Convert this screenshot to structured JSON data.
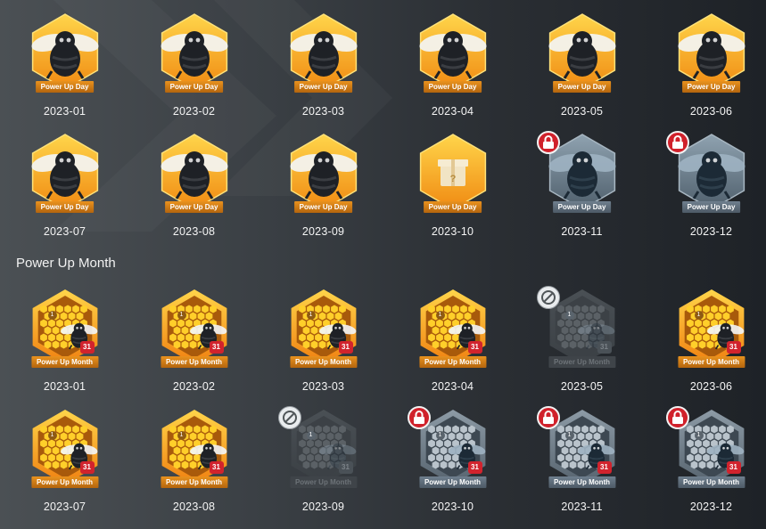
{
  "day_badges": {
    "ribbon": "Power Up Day",
    "rows": [
      [
        {
          "period": "2023-01",
          "state": "earned",
          "art": "bee-icon"
        },
        {
          "period": "2023-02",
          "state": "earned",
          "art": "bee-icon"
        },
        {
          "period": "2023-03",
          "state": "earned",
          "art": "bee-icon"
        },
        {
          "period": "2023-04",
          "state": "earned",
          "art": "bee-icon"
        },
        {
          "period": "2023-05",
          "state": "earned",
          "art": "bee-icon"
        },
        {
          "period": "2023-06",
          "state": "earned",
          "art": "bee-icon"
        }
      ],
      [
        {
          "period": "2023-07",
          "state": "earned",
          "art": "bee-icon"
        },
        {
          "period": "2023-08",
          "state": "earned",
          "art": "bee-icon"
        },
        {
          "period": "2023-09",
          "state": "earned",
          "art": "bee-icon"
        },
        {
          "period": "2023-10",
          "state": "mystery",
          "art": "gift-icon"
        },
        {
          "period": "2023-11",
          "state": "locked",
          "art": "bee-icon"
        },
        {
          "period": "2023-12",
          "state": "locked",
          "art": "bee-icon"
        }
      ]
    ]
  },
  "month_section": {
    "title": "Power Up Month",
    "ribbon": "Power Up Month",
    "badge_number": "31",
    "first_cell_number": "1",
    "rows": [
      [
        {
          "period": "2023-01",
          "state": "earned"
        },
        {
          "period": "2023-02",
          "state": "earned"
        },
        {
          "period": "2023-03",
          "state": "earned"
        },
        {
          "period": "2023-04",
          "state": "earned"
        },
        {
          "period": "2023-05",
          "state": "missed"
        },
        {
          "period": "2023-06",
          "state": "earned"
        }
      ],
      [
        {
          "period": "2023-07",
          "state": "earned"
        },
        {
          "period": "2023-08",
          "state": "earned"
        },
        {
          "period": "2023-09",
          "state": "missed"
        },
        {
          "period": "2023-10",
          "state": "locked"
        },
        {
          "period": "2023-11",
          "state": "locked"
        },
        {
          "period": "2023-12",
          "state": "locked"
        }
      ]
    ]
  },
  "colors": {
    "gold_light": "#ffd54a",
    "gold_dark": "#f08a12",
    "locked_badge": "#6f8291",
    "lock_red": "#d0212b"
  }
}
